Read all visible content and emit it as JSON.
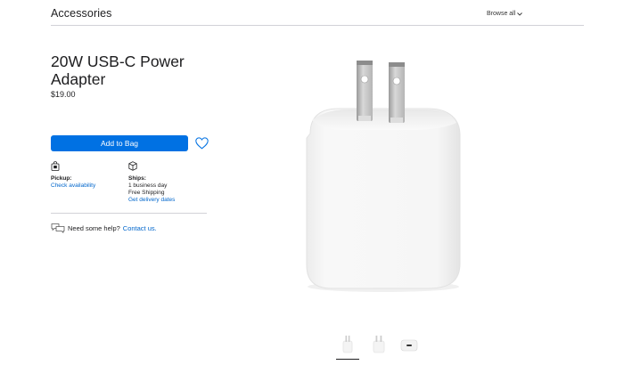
{
  "header": {
    "title": "Accessories",
    "browse_label": "Browse all"
  },
  "product": {
    "title": "20W USB-C Power Adapter",
    "price": "$19.00",
    "add_to_bag_label": "Add to Bag"
  },
  "fulfillment": {
    "pickup_label": "Pickup:",
    "pickup_link": "Check availability",
    "ships_label": "Ships:",
    "ships_time": "1 business day",
    "ships_cost": "Free Shipping",
    "ships_link": "Get delivery dates"
  },
  "help": {
    "text": "Need some help?",
    "link": "Contact us."
  },
  "icons": {
    "browse": "chevron-down-icon",
    "favorite": "heart-icon",
    "pickup": "store-bag-icon",
    "ships": "box-icon",
    "help": "chat-bubbles-icon"
  },
  "gallery": {
    "thumbnails": [
      "front-view",
      "side-view",
      "usb-port-view"
    ],
    "selected_index": 0
  },
  "colors": {
    "accent": "#0071e3",
    "link": "#0066cc",
    "text": "#1d1d1f",
    "divider": "#d2d2d7"
  }
}
